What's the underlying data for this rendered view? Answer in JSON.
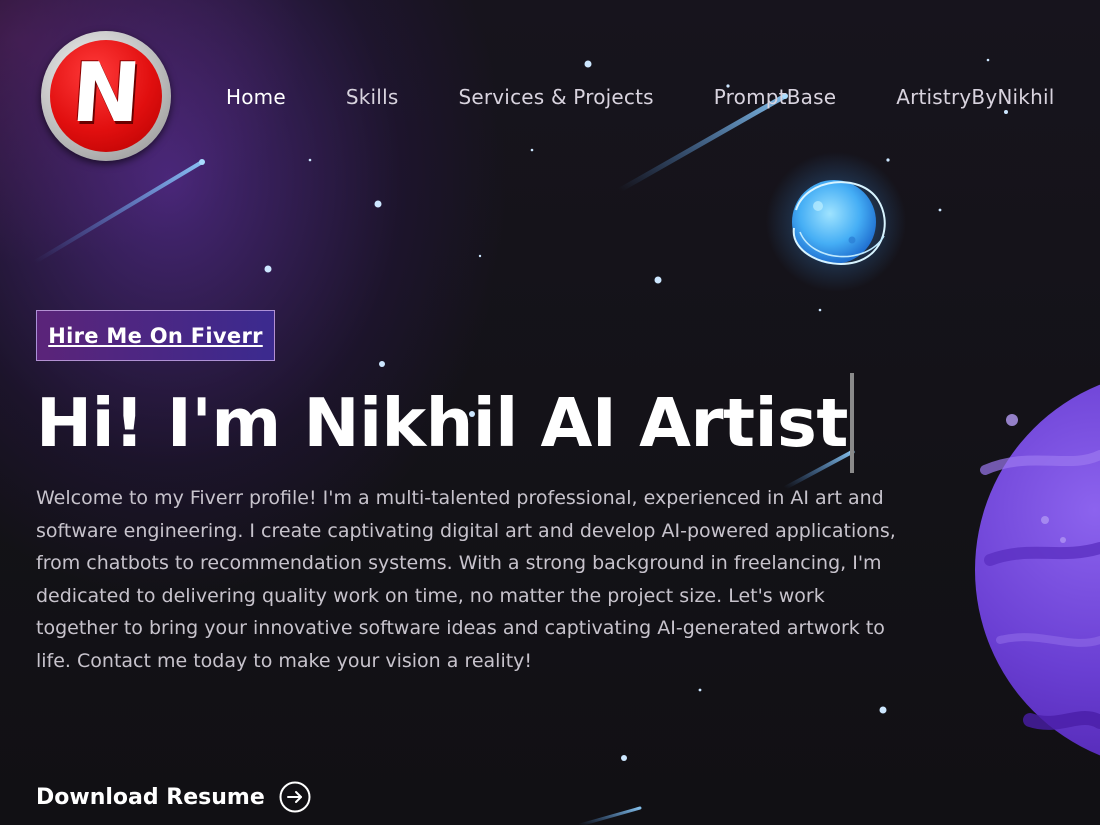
{
  "logo": {
    "letter": "N",
    "icon": "n-logo-icon",
    "colors": {
      "ring": "#c0c0c0",
      "fill": "#e10f0f",
      "letter": "#ffffff"
    }
  },
  "nav": {
    "items": [
      {
        "label": "Home",
        "active": true
      },
      {
        "label": "Skills",
        "active": false
      },
      {
        "label": "Services & Projects",
        "active": false
      },
      {
        "label": "PromptBase",
        "active": false
      },
      {
        "label": "ArtistryByNikhil",
        "active": false
      }
    ]
  },
  "hero": {
    "badge_label": "Hire Me On Fiverr",
    "headline": "Hi! I'm Nikhil AI Artist",
    "description": "Welcome to my Fiverr profile! I'm a multi-talented professional, experienced in AI art and software engineering. I create captivating digital art and develop AI-powered applications, from chatbots to recommendation systems. With a strong background in freelancing, I'm dedicated to delivering quality work on time, no matter the project size. Let's work together to bring your innovative software ideas and captivating AI-generated artwork to life. Contact me today to make your vision a reality!",
    "download_label": "Download Resume",
    "download_icon": "arrow-right-circle-icon"
  },
  "colors": {
    "background": "#121116",
    "accent_purple": "#5b2479",
    "accent_blue": "#3b2a8f",
    "planet": "#6b3fd0",
    "moon": "#5ec3ff",
    "text_primary": "#ffffff",
    "text_secondary": "#c7c3cc"
  }
}
